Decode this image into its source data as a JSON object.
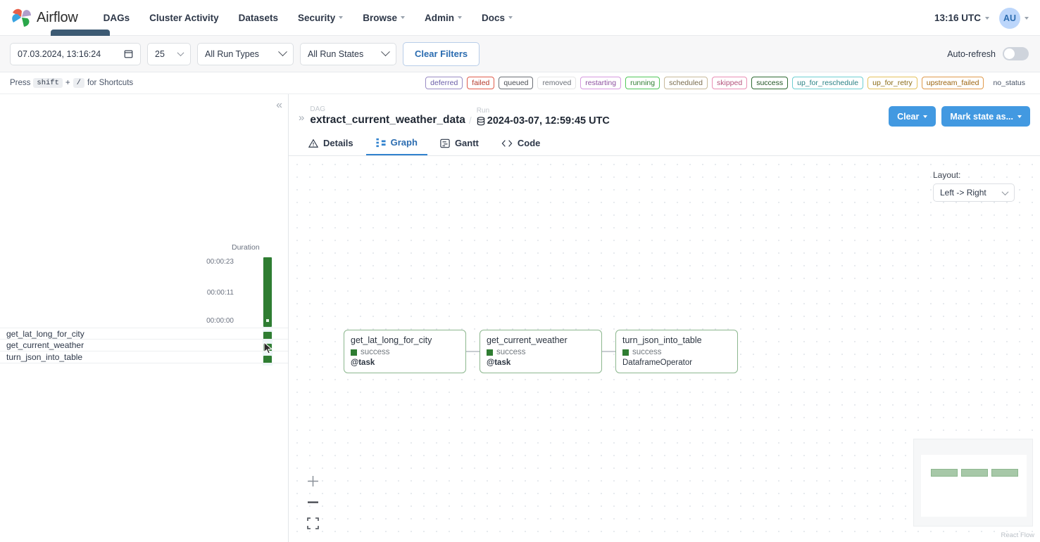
{
  "topnav": {
    "brand": "Airflow",
    "items": [
      {
        "label": "DAGs",
        "has_caret": false
      },
      {
        "label": "Cluster Activity",
        "has_caret": false
      },
      {
        "label": "Datasets",
        "has_caret": false
      },
      {
        "label": "Security",
        "has_caret": true
      },
      {
        "label": "Browse",
        "has_caret": true
      },
      {
        "label": "Admin",
        "has_caret": true
      },
      {
        "label": "Docs",
        "has_caret": true
      }
    ],
    "clock": "13:16 UTC",
    "avatar_initials": "AU"
  },
  "filters": {
    "date_value": "07.03.2024, 13:16:24",
    "page_size": "25",
    "run_type": "All Run Types",
    "run_state": "All Run States",
    "clear_label": "Clear Filters",
    "autorefresh_label": "Auto-refresh",
    "autorefresh_on": false
  },
  "shortcut": {
    "press": "Press",
    "key1": "shift",
    "plus": "+",
    "key2": "/",
    "tail": "for Shortcuts"
  },
  "legend": [
    {
      "label": "deferred",
      "border": "#9a8cc4",
      "color": "#6b5ea8"
    },
    {
      "label": "failed",
      "border": "#e05c4b",
      "color": "#b5382a"
    },
    {
      "label": "queued",
      "border": "#6b6f75",
      "color": "#4a4e54"
    },
    {
      "label": "removed",
      "border": "#e6e6e6",
      "color": "#6b7078"
    },
    {
      "label": "restarting",
      "border": "#d79ae0",
      "color": "#8e52a0"
    },
    {
      "label": "running",
      "border": "#52c75a",
      "color": "#2f7d32"
    },
    {
      "label": "scheduled",
      "border": "#c8b99a",
      "color": "#7a6c4e"
    },
    {
      "label": "skipped",
      "border": "#e98fb4",
      "color": "#b4537c"
    },
    {
      "label": "success",
      "border": "#2f6b33",
      "color": "#1f5322"
    },
    {
      "label": "up_for_reschedule",
      "border": "#6ecfd1",
      "color": "#2b8285"
    },
    {
      "label": "up_for_retry",
      "border": "#e4c25c",
      "color": "#8a6b16"
    },
    {
      "label": "upstream_failed",
      "border": "#e09a4b",
      "color": "#9c6410"
    },
    {
      "label": "no_status",
      "border": "transparent",
      "color": "#4a5568"
    }
  ],
  "left_pane": {
    "collapse_icon": "«",
    "duration_title": "Duration",
    "axis_labels": [
      "00:00:23",
      "00:00:11",
      "00:00:00"
    ],
    "tasks": [
      {
        "name": "get_lat_long_for_city"
      },
      {
        "name": "get_current_weather"
      },
      {
        "name": "turn_json_into_table"
      }
    ]
  },
  "dag_header": {
    "expand_icon": "»",
    "dag_label": "DAG",
    "dag_name": "extract_current_weather_data",
    "run_label": "Run",
    "run_value": "2024-03-07, 12:59:45 UTC",
    "clear_button": "Clear",
    "mark_state_button": "Mark state as..."
  },
  "tabs": [
    {
      "label": "Details",
      "icon": "warning-triangle-icon",
      "active": false
    },
    {
      "label": "Graph",
      "icon": "graph-nodes-icon",
      "active": true
    },
    {
      "label": "Gantt",
      "icon": "gantt-chart-icon",
      "active": false
    },
    {
      "label": "Code",
      "icon": "code-brackets-icon",
      "active": false
    }
  ],
  "graph": {
    "layout_label": "Layout:",
    "layout_value": "Left -> Right",
    "nodes": [
      {
        "title": "get_lat_long_for_city",
        "state": "success",
        "operator": "@task",
        "operator_bold": true
      },
      {
        "title": "get_current_weather",
        "state": "success",
        "operator": "@task",
        "operator_bold": true
      },
      {
        "title": "turn_json_into_table",
        "state": "success",
        "operator": "DataframeOperator",
        "operator_bold": false
      }
    ],
    "zoom_in_label": "+",
    "zoom_out_label": "−",
    "fit_view_label": "fit-view",
    "credit": "React Flow"
  },
  "colors": {
    "accent_blue": "#4299e1",
    "link_blue": "#2b6cb0",
    "success_green": "#2f7d32",
    "node_border": "#8cb78e"
  }
}
